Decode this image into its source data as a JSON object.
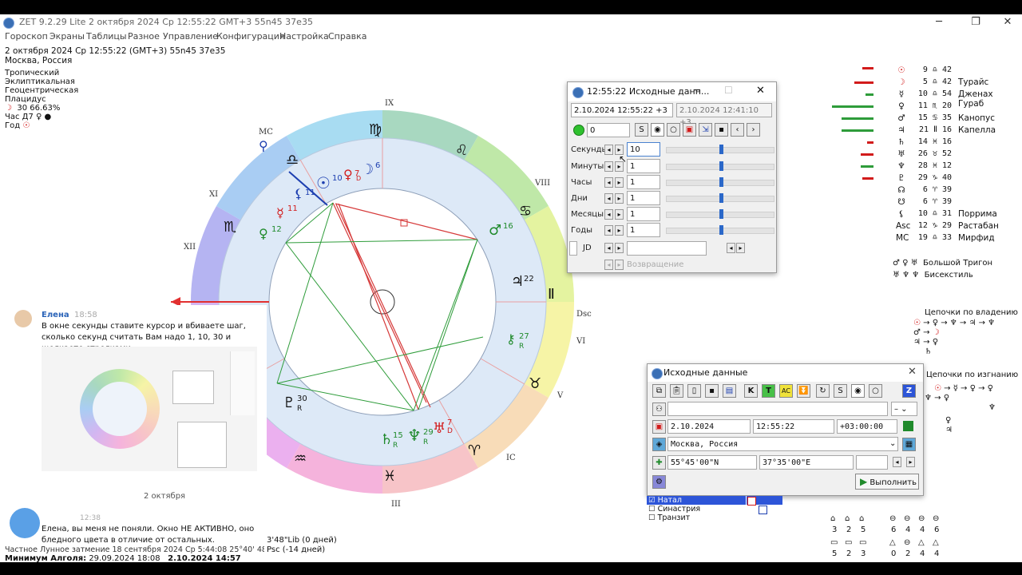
{
  "window": {
    "title": "ZET 9.2.29 Lite    2 октября 2024  Ср  12:55:22 GMT+3 55n45  37e35"
  },
  "menu": [
    "Гороскоп",
    "Экраны",
    "Таблицы",
    "Разное",
    "Управление",
    "Конфигурация",
    "Настройка",
    "Справка"
  ],
  "info": {
    "line1": "2 октября 2024  Ср  12:55:22 (GMT+3) 55n45  37e35",
    "line2": "Москва, Россия",
    "line3": "Тропический",
    "line4": "Эклиптикальная",
    "line5": "Геоцентрическая",
    "line6": "Плацидус",
    "moon_phase": "30 66.63%",
    "hour": "Час Д7",
    "year": "Год"
  },
  "chart": {
    "houses": [
      "IX",
      "VIII",
      "VII",
      "VI",
      "V",
      "IV",
      "III",
      "XII",
      "XI",
      "X"
    ],
    "house_labels": {
      "mc": "MC",
      "dsc": "Dsc",
      "ic": "IC",
      "ix": "IX",
      "viii": "VIII",
      "vi": "VI",
      "v": "V",
      "iii": "III",
      "xi": "XI",
      "xii": "XII"
    },
    "planets": {
      "sun": "10",
      "moon_top": "6",
      "venus_num": "7",
      "venus_sub": "D",
      "mars": "16",
      "jupiter": "22",
      "chiron": "27",
      "chiron_r": "R",
      "pluto": "30",
      "pluto_r": "R",
      "saturn": "15",
      "saturn_r": "R",
      "neptune": "29",
      "neptune_r": "R",
      "uranus": "7",
      "uranus_d": "D",
      "mercury": "11",
      "lilith": "11",
      "venus2": "12"
    }
  },
  "positions": [
    {
      "g": "☉",
      "deg": "9 ♎ 42",
      "star": ""
    },
    {
      "g": "☽",
      "deg": "5 ♎ 42",
      "star": "Турайс"
    },
    {
      "g": "☿",
      "deg": "10 ♎ 54",
      "star": "Дженах Гураб"
    },
    {
      "g": "♀",
      "deg": "11 ♏ 20",
      "star": ""
    },
    {
      "g": "♂",
      "deg": "15 ♋ 35",
      "star": "Канопус"
    },
    {
      "g": "♃",
      "deg": "21 Ⅱ 16",
      "star": "Капелла"
    },
    {
      "g": "♄",
      "deg": "14 ♓ 16",
      "star": ""
    },
    {
      "g": "♅",
      "deg": "26 ♉ 52",
      "star": ""
    },
    {
      "g": "♆",
      "deg": "28 ♓ 12",
      "star": ""
    },
    {
      "g": "♇",
      "deg": "29 ♑ 40",
      "star": ""
    },
    {
      "g": "☊",
      "deg": "6 ♈ 39",
      "star": ""
    },
    {
      "g": "☋",
      "deg": "6 ♈ 39",
      "star": ""
    },
    {
      "g": "⚸",
      "deg": "10 ♎ 31",
      "star": "Поррима"
    },
    {
      "g": "Asc",
      "deg": "12 ♑ 29",
      "star": "Растабан"
    },
    {
      "g": "MC",
      "deg": "19 ♎ 33",
      "star": "Мирфид"
    }
  ],
  "aspects": {
    "grand_trine": "Большой Тригон",
    "sextile": "Бисекстиль"
  },
  "chains": {
    "rulership_title": "Цепочки по владению",
    "exile_title": "Цепочки по изгнанию"
  },
  "time_dialog": {
    "title": "12:55:22 Исходные данн...",
    "field1": "2.10.2024  12:55:22  +3",
    "field2": "2.10.2024   12:41:10  +3",
    "counter": "0",
    "rows": [
      {
        "label": "Секунды",
        "value": "10"
      },
      {
        "label": "Минуты",
        "value": "1"
      },
      {
        "label": "Часы",
        "value": "1"
      },
      {
        "label": "Дни",
        "value": "1"
      },
      {
        "label": "Месяцы",
        "value": "1"
      },
      {
        "label": "Годы",
        "value": "1"
      }
    ],
    "jd_label": "JD",
    "return_label": "Возвращение"
  },
  "source_dialog": {
    "title": "Исходные данные",
    "date": "2.10.2024",
    "time": "12:55:22",
    "tz": "+03:00:00",
    "place": "Москва, Россия",
    "lat": "55°45'00\"N",
    "lon": "37°35'00\"E",
    "run": "Выполнить",
    "modes": [
      "Натал",
      "Синастрия",
      "Транзит"
    ]
  },
  "chat": {
    "name": "Елена",
    "time": "18:58",
    "message": "В окне секунды ставите курсор и вбиваете шаг, сколько секунд считать Вам надо 1, 10, 30 и щелкаете стрелками",
    "date_sep": "2 октября",
    "time2": "12:38",
    "message2": "Елена, вы меня не поняли. Окно НЕ АКТИВНО, оно бледного цвета в отличие от остальных."
  },
  "bottom": {
    "lib": "3'48\"Lib (0 дней)",
    "psc": "Psc (-14 дней)",
    "eclipse": "Частное Лунное затмение 18 сентября 2024 Ср  5:44:08 25°40' 48 23",
    "algol": "Минимум Алголя:",
    "algol_date": "29.09.2024 18:08",
    "algol_date2": "2.10.2024 14:57"
  },
  "grid_counts": {
    "row1": [
      "3",
      "2",
      "5",
      "",
      "6",
      "4",
      "4",
      "6"
    ],
    "row2": [
      "5",
      "2",
      "3",
      "",
      "0",
      "2",
      "4",
      "4"
    ]
  }
}
